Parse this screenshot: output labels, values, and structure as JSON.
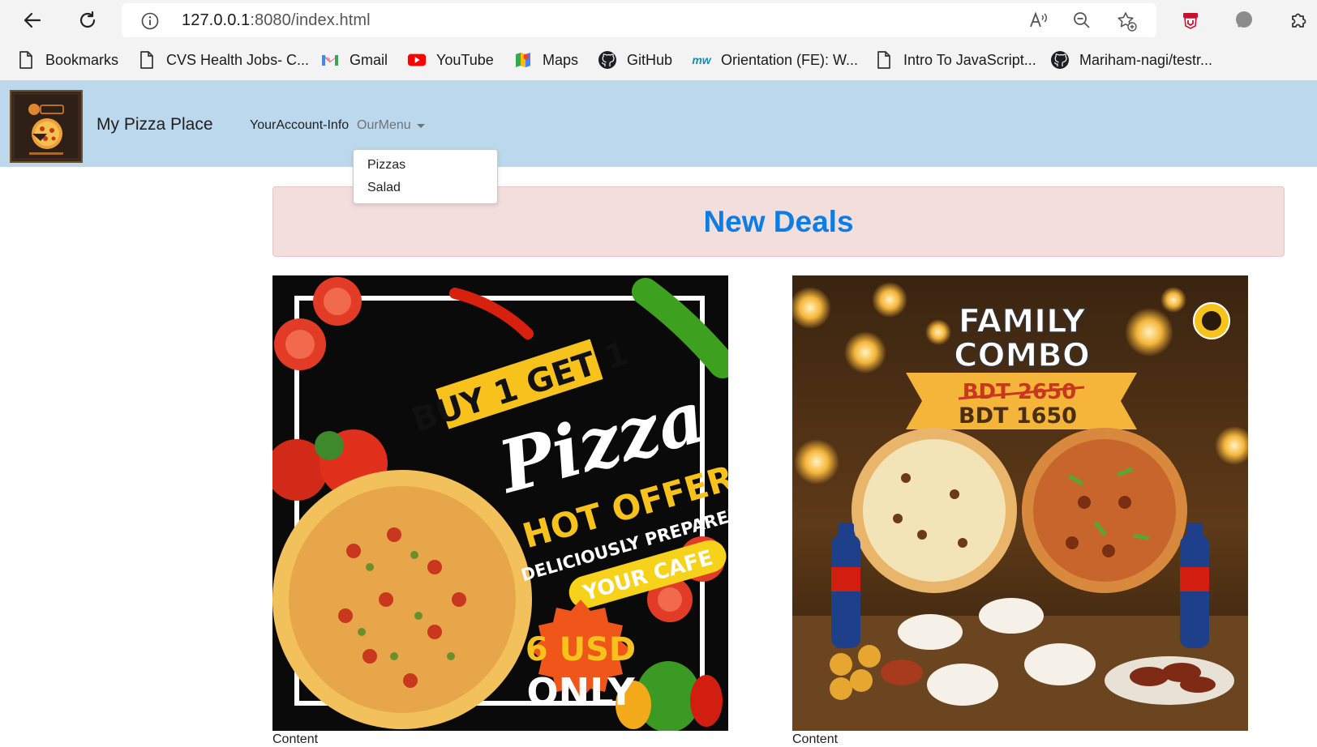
{
  "browser": {
    "url_host": "127.0.0.1",
    "url_path": ":8080/index.html",
    "bookmarks": [
      {
        "label": "Bookmarks",
        "icon": "page-icon"
      },
      {
        "label": "CVS Health Jobs- C...",
        "icon": "page-icon"
      },
      {
        "label": "Gmail",
        "icon": "gmail-icon"
      },
      {
        "label": "YouTube",
        "icon": "youtube-icon"
      },
      {
        "label": "Maps",
        "icon": "maps-icon"
      },
      {
        "label": "GitHub",
        "icon": "github-icon"
      },
      {
        "label": "Orientation (FE): W...",
        "icon": "mw-icon"
      },
      {
        "label": "Intro To JavaScript...",
        "icon": "page-icon"
      },
      {
        "label": "Mariham-nagi/testr...",
        "icon": "github-icon"
      }
    ]
  },
  "navbar": {
    "brand": "My Pizza Place",
    "links": [
      "YourAccount-Info",
      "OurMenu"
    ],
    "dropdown_items": [
      "Pizzas",
      "Salad"
    ],
    "background": "#bcd8ec"
  },
  "main": {
    "heading": "New Deals",
    "heading_color": "#0d7de4",
    "cards": [
      {
        "caption": "Content",
        "image": {
          "line1": "BUY 1 GET 1",
          "line2": "Pizza",
          "line3": "HOT OFFER",
          "line4": "DELICIOUSLY PREPARED BY",
          "line5": "YOUR CAFE",
          "price1": "6 USD",
          "price2": "ONLY"
        }
      },
      {
        "caption": "Content",
        "image": {
          "line1": "FAMILY",
          "line2": "COMBO",
          "old_price": "BDT 2650",
          "new_price": "BDT 1650"
        }
      }
    ]
  }
}
